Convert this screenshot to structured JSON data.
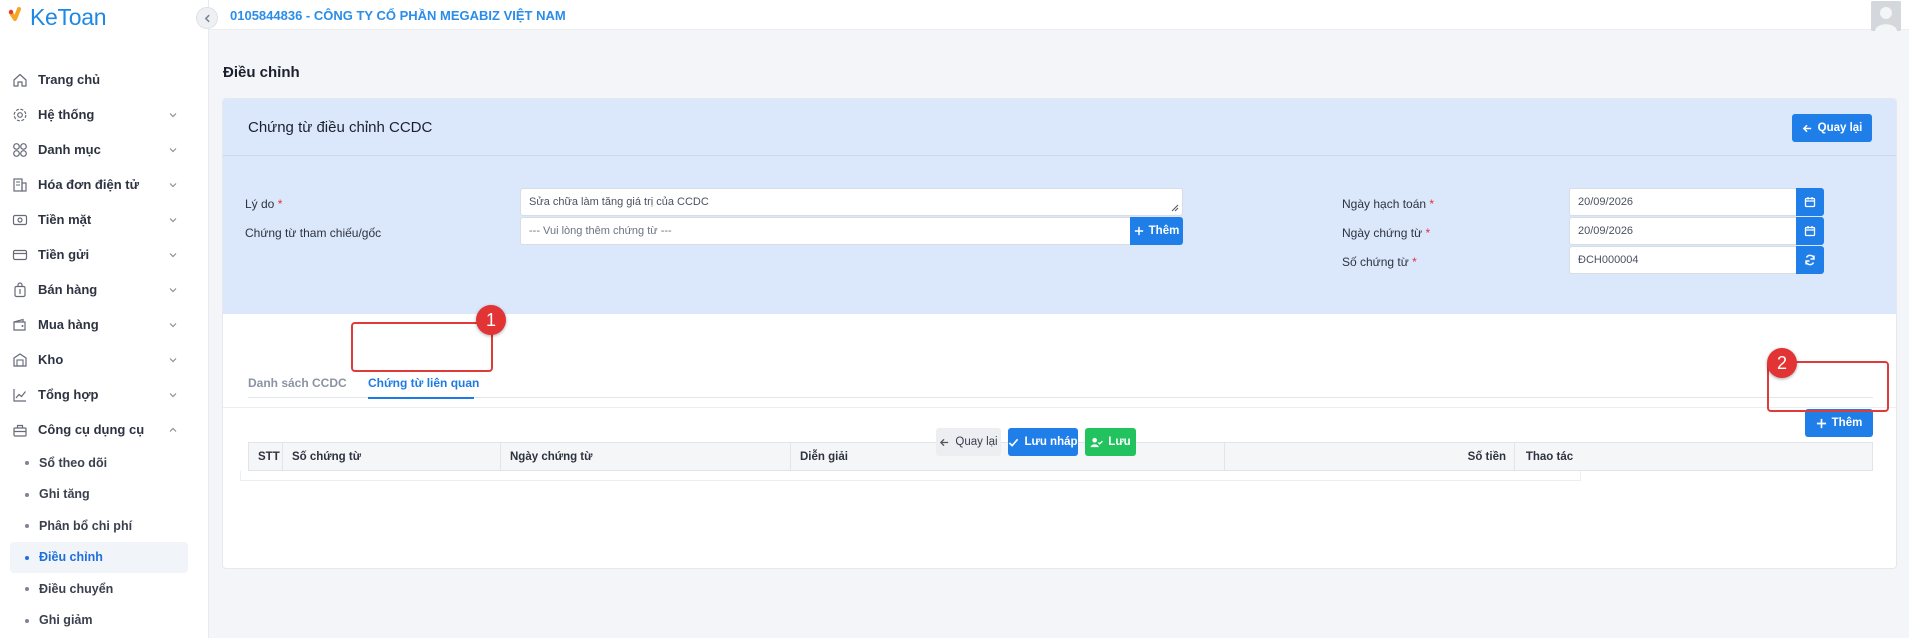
{
  "app": {
    "logo_text": "KeToan",
    "company": "0105844836 - CÔNG TY CỔ PHẦN MEGABIZ VIỆT NAM"
  },
  "sidebar": {
    "items": [
      {
        "label": "Trang chủ",
        "icon": "home-icon",
        "has_chevron": false
      },
      {
        "label": "Hệ thống",
        "icon": "gear-icon",
        "has_chevron": true
      },
      {
        "label": "Danh mục",
        "icon": "grid-icon",
        "has_chevron": true
      },
      {
        "label": "Hóa đơn điện tử",
        "icon": "invoice-icon",
        "has_chevron": true
      },
      {
        "label": "Tiền mặt",
        "icon": "cash-icon",
        "has_chevron": true
      },
      {
        "label": "Tiền gửi",
        "icon": "card-icon",
        "has_chevron": true
      },
      {
        "label": "Bán hàng",
        "icon": "bag-icon",
        "has_chevron": true
      },
      {
        "label": "Mua hàng",
        "icon": "wallet-icon",
        "has_chevron": true
      },
      {
        "label": "Kho",
        "icon": "warehouse-icon",
        "has_chevron": true
      },
      {
        "label": "Tổng hợp",
        "icon": "chart-icon",
        "has_chevron": true
      },
      {
        "label": "Công cụ dụng cụ",
        "icon": "tools-icon",
        "has_chevron": true,
        "expanded": true
      }
    ],
    "sub_items": [
      {
        "label": "Sổ theo dõi"
      },
      {
        "label": "Ghi tăng"
      },
      {
        "label": "Phân bổ chi phí"
      },
      {
        "label": "Điều chỉnh",
        "active": true
      },
      {
        "label": "Điều chuyển"
      },
      {
        "label": "Ghi giảm"
      }
    ]
  },
  "page": {
    "title": "Điều chỉnh"
  },
  "card": {
    "title": "Chứng từ điều chỉnh CCDC",
    "back_label": "Quay lại"
  },
  "form": {
    "reason_label": "Lý do",
    "reason_value": "Sửa chữa làm tăng giá trị của CCDC",
    "ref_label": "Chứng từ tham chiếu/gốc",
    "ref_placeholder": "--- Vui lòng thêm chứng từ ---",
    "ref_add_label": "Thêm",
    "accounting_date_label": "Ngày hạch toán",
    "accounting_date_value": "20/09/2026",
    "doc_date_label": "Ngày chứng từ",
    "doc_date_value": "20/09/2026",
    "doc_no_label": "Số chứng từ",
    "doc_no_value": "ĐCH000004",
    "required_mark": "*"
  },
  "tabs": [
    {
      "label": "Danh sách CCDC",
      "active": false
    },
    {
      "label": "Chứng từ liên quan",
      "active": true
    }
  ],
  "annotations": {
    "marker1": "1",
    "marker2": "2"
  },
  "table": {
    "add_label": "Thêm",
    "columns": [
      "STT",
      "Số chứng từ",
      "Ngày chứng từ",
      "Diễn giải",
      "Số tiền",
      "Thao tác"
    ]
  },
  "footer": {
    "back_label": "Quay lại",
    "draft_label": "Lưu nháp",
    "save_label": "Lưu"
  },
  "colors": {
    "primary": "#1f7ee8",
    "success": "#22c35e",
    "header_bg": "#dbe8fb",
    "annotation": "#e23434"
  }
}
